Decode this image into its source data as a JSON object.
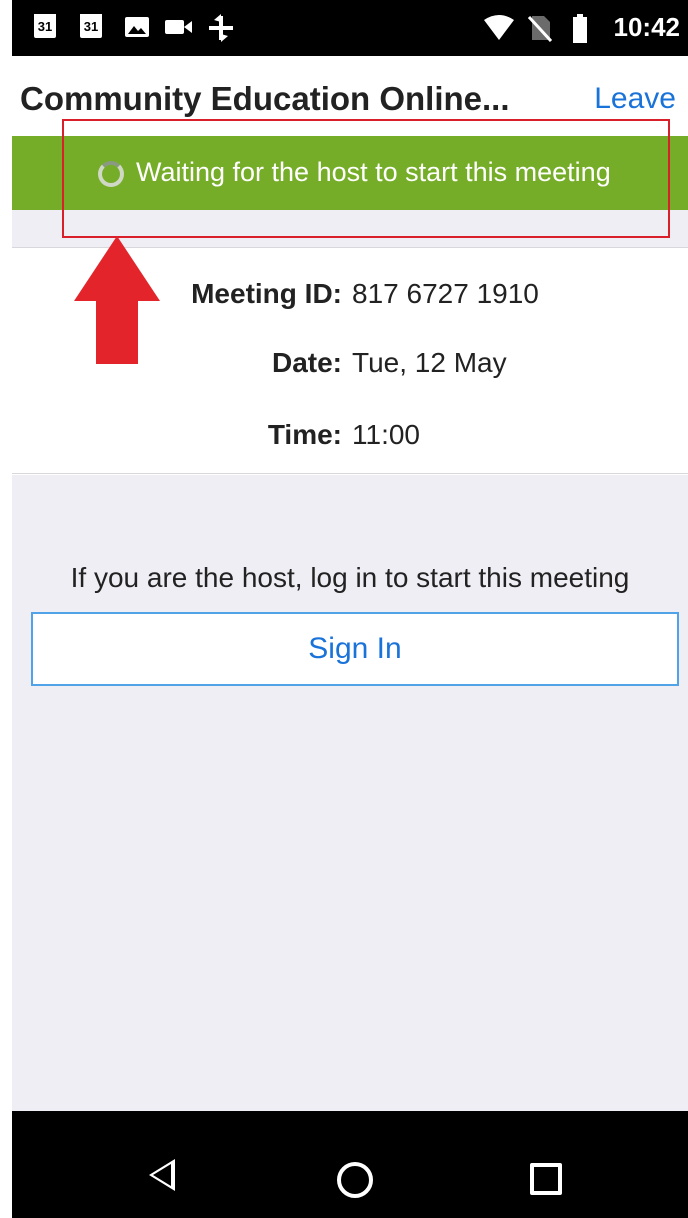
{
  "status_bar": {
    "left_icons": [
      "calendar-icon",
      "calendar-icon",
      "image-icon",
      "video-icon",
      "sync-icon"
    ],
    "calendar_day": "31",
    "right_icons": [
      "wifi-icon",
      "no-sim-icon",
      "battery-icon"
    ],
    "time": "10:42"
  },
  "header": {
    "title": "Community Education Online...",
    "leave_label": "Leave"
  },
  "banner": {
    "message": "Waiting for the host to start this meeting",
    "color": "#76ad28"
  },
  "meeting": {
    "id_label": "Meeting ID:",
    "id_value": "817 6727 1910",
    "date_label": "Date:",
    "date_value": "Tue, 12 May",
    "time_label": "Time:",
    "time_value": "11:00"
  },
  "host": {
    "message": "If you are the host, log in to start this meeting",
    "sign_in_label": "Sign In"
  },
  "nav": {
    "icons": [
      "back-icon",
      "home-icon",
      "recents-icon"
    ]
  },
  "colors": {
    "accent_blue": "#1a73d9",
    "annotation_red": "#e3242b"
  }
}
